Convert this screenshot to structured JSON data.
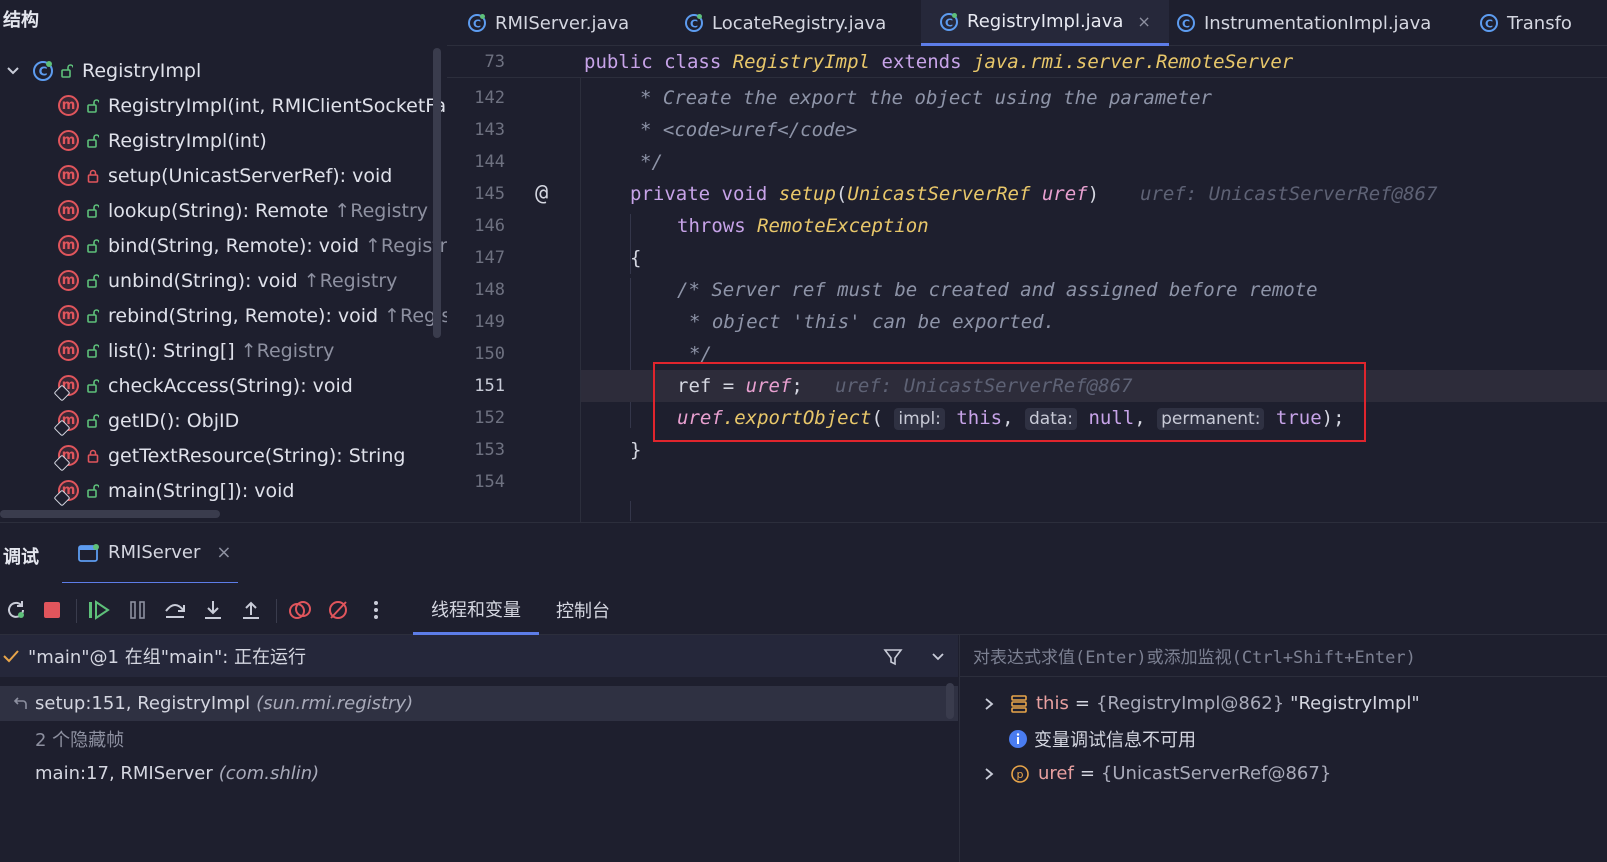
{
  "structure": {
    "title": "结构",
    "root": "RegistryImpl",
    "items": [
      {
        "sig": "RegistryImpl(int, RMIClientSocketFactory",
        "inh": "",
        "access": "public",
        "ovl": false
      },
      {
        "sig": "RegistryImpl(int)",
        "inh": "",
        "access": "public",
        "ovl": false
      },
      {
        "sig": "setup(UnicastServerRef): void",
        "inh": "",
        "access": "private",
        "ovl": false
      },
      {
        "sig": "lookup(String): Remote",
        "inh": "↑Registry",
        "access": "public",
        "ovl": false
      },
      {
        "sig": "bind(String, Remote): void",
        "inh": "↑Registry",
        "access": "public",
        "ovl": false
      },
      {
        "sig": "unbind(String): void",
        "inh": "↑Registry",
        "access": "public",
        "ovl": false
      },
      {
        "sig": "rebind(String, Remote): void",
        "inh": "↑Registry",
        "access": "public",
        "ovl": false
      },
      {
        "sig": "list(): String[]",
        "inh": "↑Registry",
        "access": "public",
        "ovl": false
      },
      {
        "sig": "checkAccess(String): void",
        "inh": "",
        "access": "public",
        "ovl": true
      },
      {
        "sig": "getID(): ObjID",
        "inh": "",
        "access": "public",
        "ovl": true
      },
      {
        "sig": "getTextResource(String): String",
        "inh": "",
        "access": "private",
        "ovl": true
      },
      {
        "sig": "main(String[]): void",
        "inh": "",
        "access": "public",
        "ovl": true
      }
    ]
  },
  "tabs": [
    {
      "label": "RMIServer.java"
    },
    {
      "label": "LocateRegistry.java"
    },
    {
      "label": "RegistryImpl.java",
      "close": "×"
    },
    {
      "label": "InstrumentationImpl.java"
    },
    {
      "label": "Transfo"
    }
  ],
  "editor": {
    "sticky": {
      "num": "73",
      "kw1": "public class ",
      "name": "RegistryImpl",
      "kw2": " extends ",
      "parent": "java.rmi.server.RemoteServer"
    },
    "lines": {
      "142": {
        "num": "142",
        "c": "* Create the export the object using the parameter"
      },
      "143": {
        "num": "143",
        "c": "* <code>uref</code>"
      },
      "144": {
        "num": "144",
        "c": "*/"
      },
      "145": {
        "num": "145",
        "kw": "private void ",
        "fn": "setup",
        "p1": "(",
        "typ": "UnicastServerRef ",
        "pv": "uref",
        "p2": ")",
        "hint": "uref: UnicastServerRef@867"
      },
      "146": {
        "num": "146",
        "kw": "throws ",
        "typ": "RemoteException"
      },
      "147": {
        "num": "147",
        "p": "{"
      },
      "148": {
        "num": "148",
        "c": "/* Server ref must be created and assigned before remote"
      },
      "149": {
        "num": "149",
        "c": "* object 'this' can be exported."
      },
      "150": {
        "num": "150",
        "c": "*/"
      },
      "151": {
        "num": "151",
        "p1": "ref = ",
        "pv": "uref",
        "p2": ";",
        "hint": "uref: UnicastServerRef@867"
      },
      "152": {
        "num": "152",
        "pv": "uref",
        "fn": ".exportObject",
        "p1": "( ",
        "h1": "impl:",
        "v1": " this",
        "p2": ", ",
        "h2": "data:",
        "v2": " null",
        "p3": ", ",
        "h3": "permanent:",
        "v3": " true",
        "p4": ");"
      },
      "153": {
        "num": "153",
        "p": "}"
      },
      "154": {
        "num": "154"
      }
    },
    "at_marker": "@"
  },
  "debug": {
    "title": "调试",
    "session_tab": "RMIServer",
    "close": "×",
    "sub_tabs": [
      "线程和变量",
      "控制台"
    ],
    "thread": "\"main\"@1 在组\"main\": 正在运行",
    "frames": [
      {
        "method": "setup:151, RegistryImpl",
        "pkg": "(sun.rmi.registry)"
      },
      {
        "method": "2 个隐藏帧",
        "pkg": ""
      },
      {
        "method": "main:17, RMIServer",
        "pkg": "(com.shlin)"
      }
    ],
    "eval_placeholder": "对表达式求值(Enter)或添加监视(Ctrl+Shift+Enter)",
    "vars": [
      {
        "name": "this",
        "eq": "=",
        "val": "{RegistryImpl@862}",
        "str": "\"RegistryImpl\""
      },
      {
        "info": "变量调试信息不可用"
      },
      {
        "name": "uref",
        "eq": "=",
        "val": "{UnicastServerRef@867}",
        "str": ""
      }
    ]
  },
  "colors": {
    "accent": "#5d7de8",
    "highlight_box": "#e0252d",
    "method_icon": "#e0555c"
  }
}
